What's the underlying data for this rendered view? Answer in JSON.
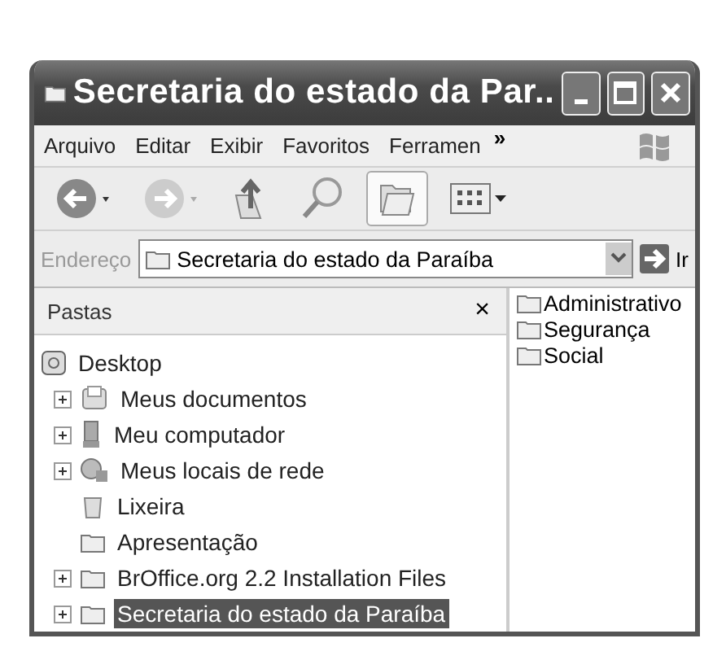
{
  "window": {
    "title": "Secretaria do estado da Par.."
  },
  "menu": [
    {
      "label": "Arquivo"
    },
    {
      "label": "Editar"
    },
    {
      "label": "Exibir"
    },
    {
      "label": "Favoritos"
    },
    {
      "label": "Ferramen"
    }
  ],
  "menu_more": "»",
  "address": {
    "label": "Endereço",
    "value": "Secretaria do estado da Paraíba",
    "go": "Ir"
  },
  "folders_pane": {
    "title": "Pastas",
    "close": "×",
    "tree": [
      {
        "label": "Desktop",
        "kind": "desktop",
        "selected": false,
        "children": [
          {
            "label": "Meus documentos",
            "kind": "documents",
            "expandable": true,
            "selected": false
          },
          {
            "label": "Meu computador",
            "kind": "computer",
            "expandable": true,
            "selected": false
          },
          {
            "label": "Meus locais de rede",
            "kind": "network",
            "expandable": true,
            "selected": false
          },
          {
            "label": "Lixeira",
            "kind": "trash",
            "expandable": false,
            "selected": false
          },
          {
            "label": "Apresentação",
            "kind": "folder",
            "expandable": false,
            "selected": false
          },
          {
            "label": "BrOffice.org 2.2 Installation Files",
            "kind": "folder",
            "expandable": true,
            "selected": false
          },
          {
            "label": "Secretaria do estado da Paraíba",
            "kind": "folder",
            "expandable": true,
            "selected": true
          }
        ]
      }
    ]
  },
  "files": [
    {
      "label": "Administrativo"
    },
    {
      "label": "Segurança"
    },
    {
      "label": "Social"
    }
  ]
}
